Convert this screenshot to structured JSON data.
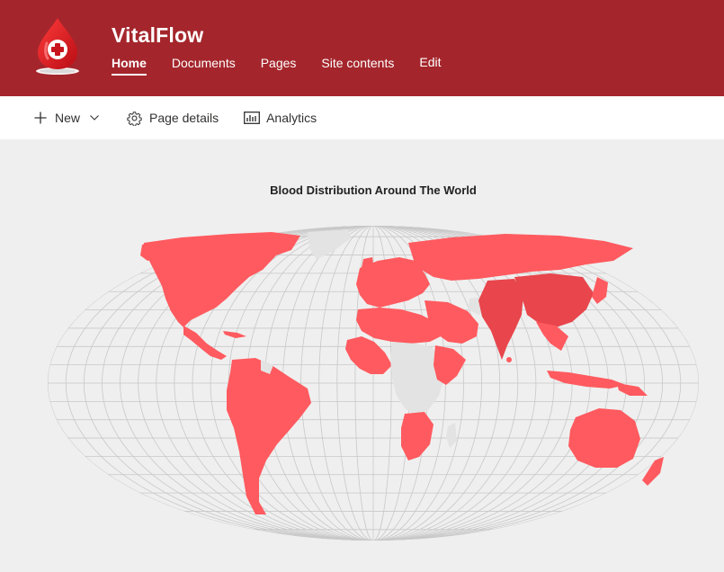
{
  "site": {
    "title": "VitalFlow"
  },
  "nav": {
    "items": [
      {
        "label": "Home",
        "active": true
      },
      {
        "label": "Documents",
        "active": false
      },
      {
        "label": "Pages",
        "active": false
      },
      {
        "label": "Site contents",
        "active": false
      }
    ],
    "edit_label": "Edit"
  },
  "commandbar": {
    "new_label": "New",
    "page_details_label": "Page details",
    "analytics_label": "Analytics"
  },
  "map": {
    "title": "Blood Distribution Around The World",
    "colors": {
      "highlight": "#ff5a5f",
      "dark_highlight": "#e8454c",
      "inactive": "#e3e3e3",
      "grid": "#c8c8c8"
    },
    "highlighted_regions": [
      "North America",
      "Central America",
      "South America",
      "Greenland (partial)",
      "Europe",
      "Russia",
      "Middle East",
      "West Africa",
      "North Africa",
      "Horn of Africa",
      "Southern Africa",
      "India",
      "China",
      "Southeast Asia",
      "Japan",
      "Australia",
      "New Zealand"
    ],
    "inactive_regions": [
      "Greenland",
      "Central Africa",
      "Madagascar",
      "Central Asia (partial)"
    ]
  }
}
